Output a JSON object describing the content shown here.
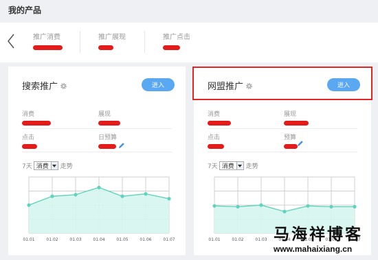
{
  "page_title": "我的产品",
  "summary": {
    "items": [
      {
        "label": "推广消费",
        "value_redacted": true
      },
      {
        "label": "推广展现",
        "value_redacted": true
      },
      {
        "label": "推广点击",
        "value_redacted": true
      }
    ]
  },
  "cards": [
    {
      "title": "搜索推广",
      "enter_label": "进入",
      "highlighted": false,
      "stats": [
        {
          "label": "消费"
        },
        {
          "label": "展现"
        },
        {
          "label": "点击"
        },
        {
          "label": "日预算"
        }
      ],
      "filter": {
        "period": "7天",
        "metric": "消费",
        "suffix": "走势"
      },
      "chart_data": {
        "type": "area",
        "x": [
          "01.01",
          "01.02",
          "01.03",
          "01.04",
          "01.05",
          "01.06",
          "01.07"
        ],
        "values": [
          3.5,
          4.6,
          4.8,
          5.7,
          4.6,
          4.9,
          4.3
        ],
        "ylim": [
          0,
          7
        ],
        "grid": true
      }
    },
    {
      "title": "网盟推广",
      "enter_label": "进入",
      "highlighted": true,
      "stats": [
        {
          "label": "消费"
        },
        {
          "label": "展现"
        },
        {
          "label": "点击"
        },
        {
          "label": "预算"
        }
      ],
      "filter": {
        "period": "7天",
        "metric": "消费",
        "suffix": "走势"
      },
      "chart_data": {
        "type": "area",
        "x": [
          "01.01",
          "01.02",
          "01.03",
          "01.04",
          "01.05",
          "01.06",
          "01.07"
        ],
        "values": [
          3.4,
          3.3,
          3.5,
          2.7,
          3.4,
          3.3,
          3.3
        ],
        "ylim": [
          0,
          7
        ],
        "grid": true
      }
    }
  ],
  "watermark": {
    "cn": "马海祥博客",
    "url": "www.mahaixiang.cn"
  },
  "colors": {
    "accent": "#5aa7f2",
    "redact": "#e41b1b",
    "highlight": "#e12525",
    "chart_line": "#5fd3be",
    "chart_fill": "#d6f5ef"
  }
}
